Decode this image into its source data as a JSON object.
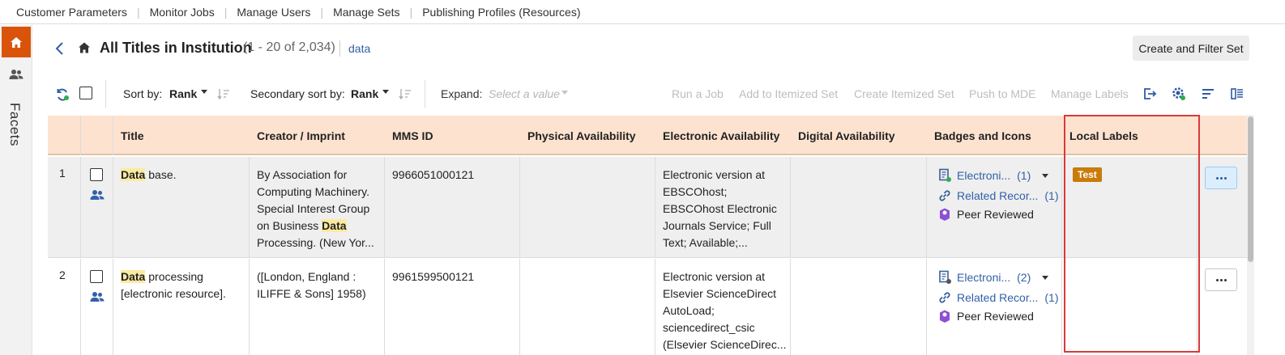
{
  "top_nav": [
    "Customer Parameters",
    "Monitor Jobs",
    "Manage Users",
    "Manage Sets",
    "Publishing Profiles (Resources)"
  ],
  "rail": {
    "facets_label": "Facets"
  },
  "header": {
    "title": "All Titles in Institution",
    "count": "(1 - 20 of 2,034)",
    "query": "data",
    "create_filter_label": "Create and Filter Set"
  },
  "toolbar": {
    "sort_label": "Sort by:",
    "sort_value": "Rank",
    "secondary_sort_label": "Secondary sort by:",
    "secondary_sort_value": "Rank",
    "expand_label": "Expand:",
    "expand_placeholder": "Select a value",
    "actions": [
      "Run a Job",
      "Add to Itemized Set",
      "Create Itemized Set",
      "Push to MDE",
      "Manage Labels"
    ]
  },
  "table": {
    "columns": [
      "Title",
      "Creator / Imprint",
      "MMS ID",
      "Physical Availability",
      "Electronic Availability",
      "Digital Availability",
      "Badges and Icons",
      "Local Labels"
    ],
    "rows": [
      {
        "num": "1",
        "title_hl": "Data",
        "title_rest": " base.",
        "creator": [
          "By Association for",
          "Computing Machinery.",
          "Special Interest Group",
          "on Business "
        ],
        "creator_hl": "Data",
        "creator_end": "Processing. (New Yor...",
        "mms_id": "9966051000121",
        "electronic": [
          "Electronic version at",
          "EBSCOhost;",
          "EBSCOhost Electronic",
          "Journals Service; Full",
          "Text; Available;..."
        ],
        "badge_electronic": "Electroni...",
        "badge_electronic_count": "(1)",
        "badge_related": "Related Recor...",
        "badge_related_count": "(1)",
        "badge_peer": "Peer Reviewed",
        "local_label": "Test"
      },
      {
        "num": "2",
        "title_hl": "Data",
        "title_rest": " processing",
        "title_line2": "[electronic resource].",
        "creator": [
          "([London, England :",
          "ILIFFE & Sons] 1958)"
        ],
        "mms_id": "9961599500121",
        "electronic": [
          "Electronic version at",
          "Elsevier ScienceDirect",
          "AutoLoad;",
          "sciencedirect_csic",
          "(Elsevier ScienceDirec..."
        ],
        "badge_electronic": "Electroni...",
        "badge_electronic_count": "(2)",
        "badge_related": "Related Recor...",
        "badge_related_count": "(1)",
        "badge_peer": "Peer Reviewed"
      }
    ]
  },
  "colors": {
    "accent_orange": "#d9540a",
    "header_row": "#fde3cf",
    "highlight_box": "#d83a3a",
    "link_blue": "#3261a8",
    "label_tag": "#c97c09"
  }
}
